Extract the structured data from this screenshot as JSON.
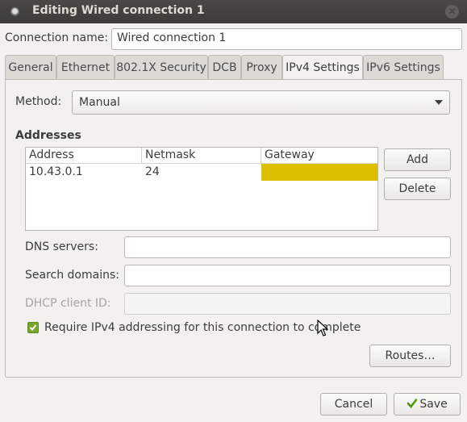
{
  "window": {
    "title": "Editing Wired connection 1"
  },
  "connection": {
    "label": "Connection name:",
    "value": "Wired connection 1"
  },
  "tabs": [
    {
      "label": "General"
    },
    {
      "label": "Ethernet"
    },
    {
      "label": "802.1X Security"
    },
    {
      "label": "DCB"
    },
    {
      "label": "Proxy"
    },
    {
      "label": "IPv4 Settings"
    },
    {
      "label": "IPv6 Settings"
    }
  ],
  "active_tab": "IPv4 Settings",
  "method": {
    "label": "Method:",
    "value": "Manual"
  },
  "addresses": {
    "heading": "Addresses",
    "columns": [
      "Address",
      "Netmask",
      "Gateway"
    ],
    "rows": [
      [
        "10.43.0.1",
        "24",
        ""
      ]
    ],
    "add_label": "Add",
    "delete_label": "Delete"
  },
  "dns": {
    "label": "DNS servers:",
    "value": ""
  },
  "search": {
    "label": "Search domains:",
    "value": ""
  },
  "dhcp": {
    "label": "DHCP client ID:",
    "value": ""
  },
  "require": {
    "label": "Require IPv4 addressing for this connection to complete",
    "checked": true
  },
  "routes_label": "Routes…",
  "footer": {
    "cancel_label": "Cancel",
    "save_label": "Save"
  },
  "colors": {
    "accent_check": "#7aa330",
    "editing_cell": "#dcc000",
    "titlebar": "#3c3b37"
  }
}
